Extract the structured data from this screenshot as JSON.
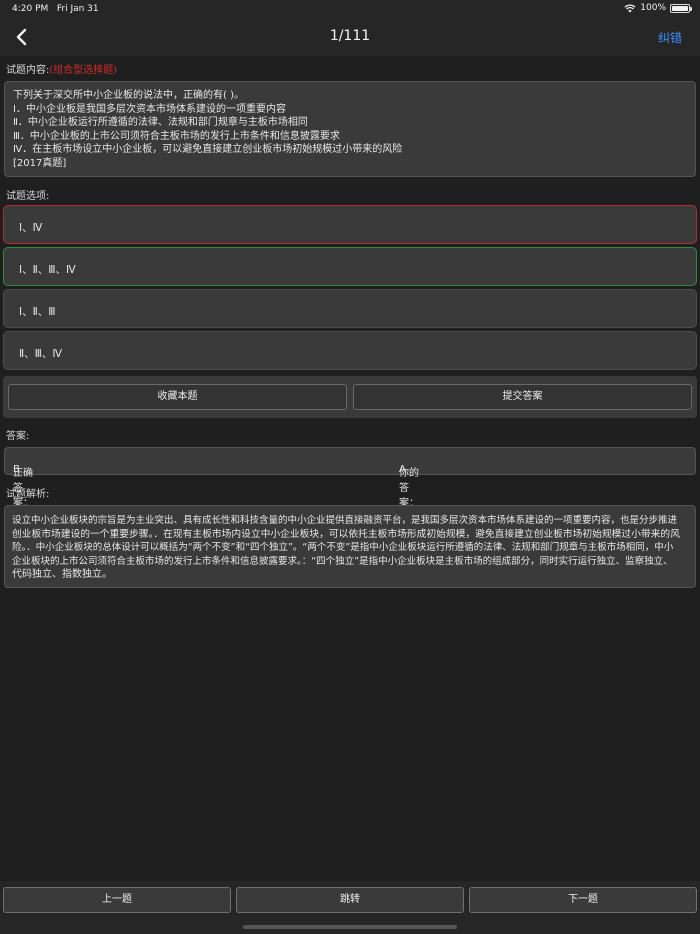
{
  "status": {
    "time": "4:20 PM",
    "date": "Fri Jan 31",
    "battery": "100%"
  },
  "nav": {
    "title": "1/111",
    "action": "纠错"
  },
  "question": {
    "label": "试题内容:",
    "type_tag": "(组合型选择题)",
    "lines": [
      "下列关于深交所中小企业板的说法中，正确的有( )。",
      "Ⅰ．中小企业板是我国多层次资本市场体系建设的一项重要内容",
      "Ⅱ．中小企业板运行所遵循的法律、法规和部门规章与主板市场相同",
      "Ⅲ．中小企业板的上市公司须符合主板市场的发行上市条件和信息披露要求",
      "Ⅳ．在主板市场设立中小企业板，可以避免直接建立创业板市场初始规模过小带来的风险",
      "[2017真题]"
    ]
  },
  "options": {
    "label": "试题选项:",
    "items": [
      {
        "text": "Ⅰ、Ⅳ",
        "state": "wrong"
      },
      {
        "text": "Ⅰ、Ⅱ、Ⅲ、Ⅳ",
        "state": "correct"
      },
      {
        "text": "Ⅰ、Ⅱ、Ⅲ",
        "state": "normal"
      },
      {
        "text": "Ⅱ、Ⅲ、Ⅳ",
        "state": "normal"
      }
    ]
  },
  "actions": {
    "favorite": "收藏本题",
    "submit": "提交答案"
  },
  "answer": {
    "label": "答案:",
    "correct_label": "正确答案：",
    "correct_value": "B",
    "yours_label": "你的答案：",
    "yours_value": "A"
  },
  "analysis": {
    "label": "试题解析:",
    "lines": [
      "设立中小企业板块的宗旨是为主业突出、具有成长性和科技含量的中小企业提供直接融资平台，是我国多层次资本市场体系建设的一项重要内容，也是分步推进",
      "创业板市场建设的一个重要步骤。．在现有主板市场内设立中小企业板块，可以依托主板市场形成初始规模，避免直接建立创业板市场初始规模过小带来的风",
      "险。．中小企业板块的总体设计可以概括为“两个不变”和“四个独立”。“两个不变”是指中小企业板块运行所遵循的法律、法规和部门规章与主板市场相同，中小",
      "企业板块的上市公司须符合主板市场的发行上市条件和信息披露要求。：“四个独立”是指中小企业板块是主板市场的组成部分，同时实行运行独立、监察独立、",
      "代码独立、指数独立。"
    ]
  },
  "bottom": {
    "prev": "上一题",
    "jump": "跳转",
    "next": "下一题"
  },
  "colors": {
    "accent": "#3b8dff",
    "wrong": "#b52a2a",
    "correct": "#2f8a3a",
    "tag": "#d22b2b"
  }
}
